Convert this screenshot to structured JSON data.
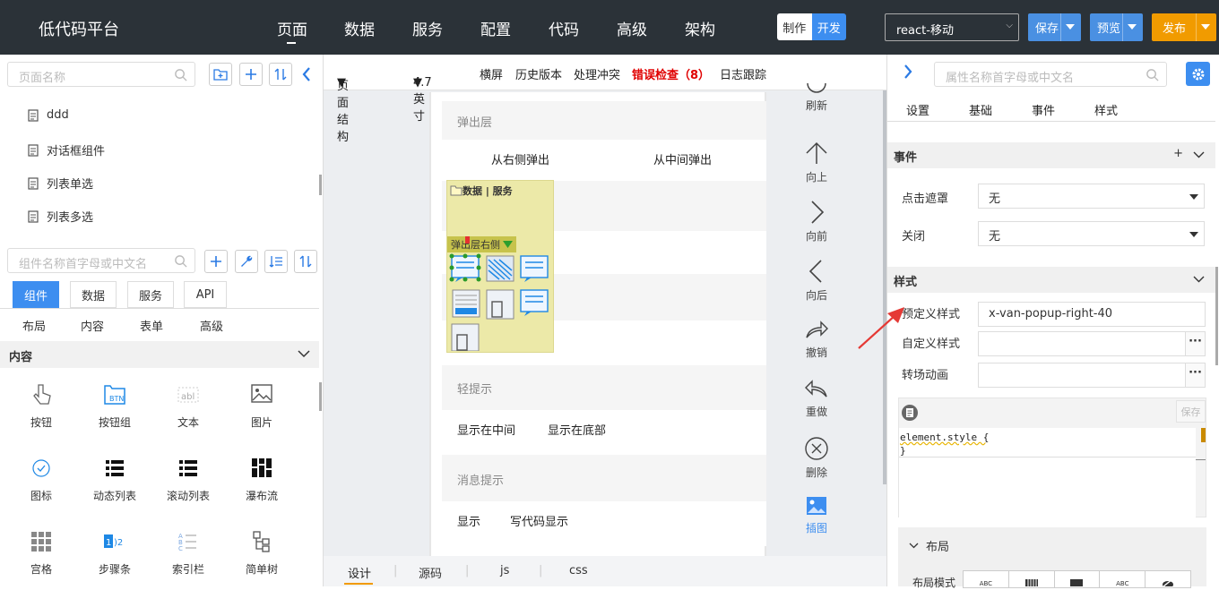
{
  "topbar": {
    "title": "低代码平台",
    "nav": [
      "页面",
      "数据",
      "服务",
      "配置",
      "代码",
      "高级",
      "架构"
    ],
    "mode_make": "制作",
    "mode_dev": "开发",
    "platform": "react-移动",
    "save": "保存",
    "preview": "预览",
    "publish": "发布"
  },
  "left": {
    "page_search_placeholder": "页面名称",
    "pages": [
      "ddd",
      "对话框组件",
      "列表单选",
      "列表多选"
    ],
    "comp_search_placeholder": "组件名称首字母或中文名",
    "tabs": [
      "组件",
      "数据",
      "服务",
      "API"
    ],
    "subtabs": [
      "布局",
      "内容",
      "表单",
      "高级"
    ],
    "section": "内容",
    "components": [
      "按钮",
      "按钮组",
      "文本",
      "图片",
      "图标",
      "动态列表",
      "滚动列表",
      "瀑布流",
      "宫格",
      "步骤条",
      "索引栏",
      "简单树"
    ]
  },
  "center": {
    "toolbar": {
      "structure": "页面结构",
      "size": "4.7 英寸",
      "landscape": "横屏",
      "history": "历史版本",
      "conflict": "处理冲突",
      "errors": "错误检查（8）",
      "log": "日志跟踪"
    },
    "phone": {
      "sec_popup": "弹出层",
      "popup_right": "从右侧弹出",
      "popup_center": "从中间弹出",
      "sec_toast": "轻提示",
      "toast_center": "显示在中间",
      "toast_bottom": "显示在底部",
      "sec_notify": "消息提示",
      "notify_show": "显示",
      "notify_code": "写代码显示",
      "overlay_title": "数据 | 服务",
      "overlay_tag": "弹出层右侧"
    },
    "side_tools": [
      "刷新",
      "向上",
      "向前",
      "向后",
      "撤销",
      "重做",
      "删除",
      "插图"
    ],
    "bottom_tabs": [
      "设计",
      "源码",
      "js",
      "css"
    ]
  },
  "right": {
    "search_placeholder": "属性名称首字母或中文名",
    "tabs": [
      "设置",
      "基础",
      "事件",
      "样式"
    ],
    "events_header": "事件",
    "event_click_mask_label": "点击遮罩",
    "event_click_mask_value": "无",
    "event_close_label": "关闭",
    "event_close_value": "无",
    "style_header": "样式",
    "predef_label": "预定义样式",
    "predef_value": "x-van-popup-right-40",
    "custom_label": "自定义样式",
    "transition_label": "转场动画",
    "code_save": "保存",
    "code_line1": "element.style {",
    "code_line2": "}",
    "layout_header": "布局",
    "layout_mode_label": "布局模式"
  },
  "colors": {
    "topbar": "#2b3238",
    "accent": "#3d8ef0",
    "save": "#4a90e2",
    "publish": "#f19b00",
    "error": "#e00000",
    "overlay": "#ece9a8"
  }
}
